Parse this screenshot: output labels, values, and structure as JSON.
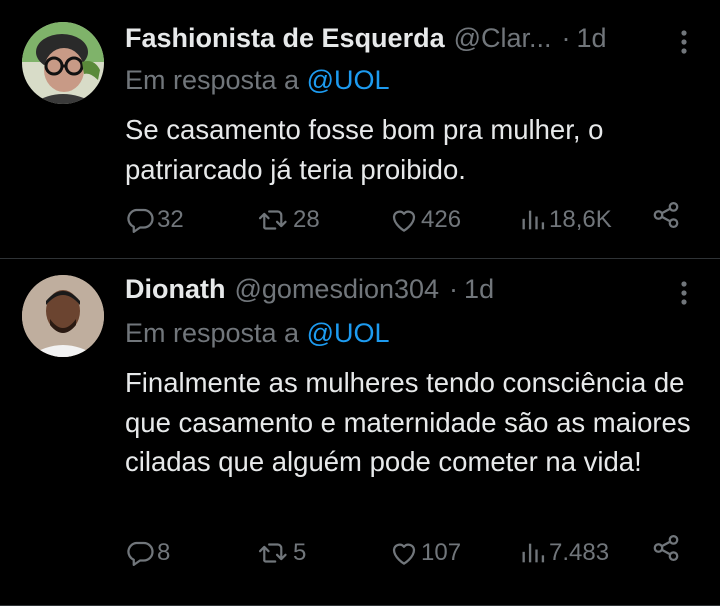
{
  "tweets": [
    {
      "name": "Fashionista de Esquerda",
      "handle": "@Clar...",
      "time": "1d",
      "reply_prefix": "Em resposta a ",
      "reply_mention": "@UOL",
      "text": "Se casamento fosse bom pra mulher, o patriarcado já teria proibido.",
      "replies": "32",
      "retweets": "28",
      "likes": "426",
      "views": "18,6K"
    },
    {
      "name": "Dionath",
      "handle": "@gomesdion304",
      "time": "1d",
      "reply_prefix": "Em resposta a ",
      "reply_mention": "@UOL",
      "text": "Finalmente as mulheres tendo consciência de que casamento e maternidade são as maiores ciladas que alguém pode cometer na vida!",
      "replies": "8",
      "retweets": "5",
      "likes": "107",
      "views": "7.483"
    }
  ],
  "icons": [
    "reply-icon",
    "retweet-icon",
    "like-icon",
    "views-icon",
    "share-icon",
    "more-icon"
  ],
  "colors": {
    "background": "#000000",
    "text": "#e7e9ea",
    "muted": "#71767b",
    "link": "#1d9bf0",
    "divider": "#2f3336"
  }
}
